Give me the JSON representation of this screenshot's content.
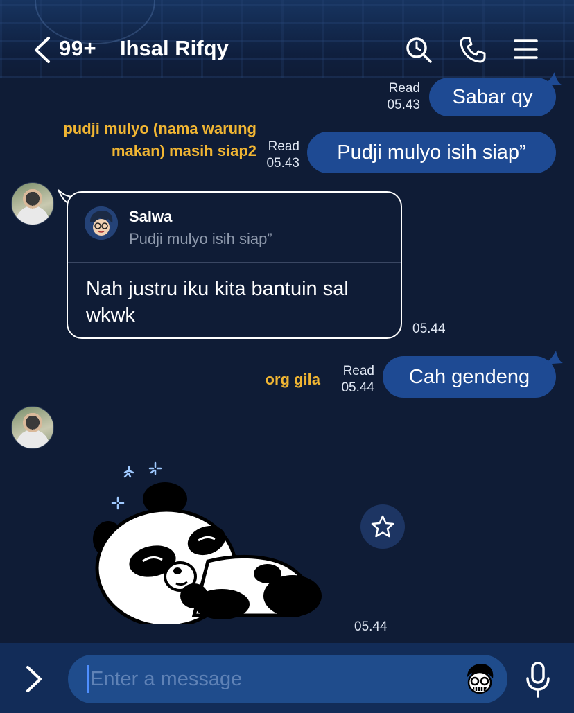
{
  "header": {
    "unread_count": "99+",
    "contact_name": "Ihsal Rifqy",
    "icons": [
      "chevron-left-icon",
      "search-icon",
      "phone-icon",
      "menu-icon"
    ]
  },
  "messages": {
    "m1": {
      "status": "Read",
      "time": "05.43",
      "text": "Sabar qy"
    },
    "m2": {
      "note": "pudji mulyo (nama warung makan) masih siap2",
      "status": "Read",
      "time": "05.43",
      "text": "Pudji mulyo isih siap”"
    },
    "m3": {
      "reply_to_name": "Salwa",
      "reply_to_text": "Pudji mulyo isih siap”",
      "text": "Nah justru iku kita bantuin sal wkwk",
      "time": "05.44"
    },
    "m4": {
      "note": "org gila",
      "status": "Read",
      "time": "05.44",
      "text": "Cah gendeng"
    },
    "m5": {
      "sticker": "sleeping-panda",
      "time": "05.44"
    }
  },
  "composer": {
    "placeholder": "Enter a message"
  },
  "colors": {
    "background": "#0f1c36",
    "outgoing_bubble": "#1e4a93",
    "note_text": "#f0b533",
    "input_bar": "#122c58"
  }
}
